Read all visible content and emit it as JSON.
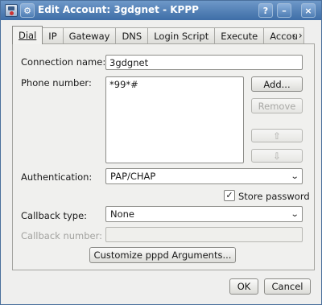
{
  "window": {
    "title": "Edit Account: 3gdgnet - KPPP",
    "help_label": "?",
    "min_label": "–",
    "close_label": "×"
  },
  "tabs": [
    {
      "label": "Dial"
    },
    {
      "label": "IP"
    },
    {
      "label": "Gateway"
    },
    {
      "label": "DNS"
    },
    {
      "label": "Login Script"
    },
    {
      "label": "Execute"
    },
    {
      "label": "Accou"
    }
  ],
  "tab_scroll": {
    "left": "‹",
    "right": "›"
  },
  "form": {
    "connection_name_label": "Connection name:",
    "connection_name_value": "3gdgnet",
    "phone_number_label": "Phone number:",
    "phone_numbers": [
      "*99*#"
    ],
    "add_label": "Add...",
    "remove_label": "Remove",
    "move_up_label": "⇧",
    "move_down_label": "⇩",
    "authentication_label": "Authentication:",
    "authentication_value": "PAP/CHAP",
    "store_password_label": "Store password",
    "store_password_checked": true,
    "callback_type_label": "Callback type:",
    "callback_type_value": "None",
    "callback_number_label": "Callback number:",
    "callback_number_value": "",
    "customize_label": "Customize pppd Arguments..."
  },
  "footer": {
    "ok_label": "OK",
    "cancel_label": "Cancel"
  }
}
